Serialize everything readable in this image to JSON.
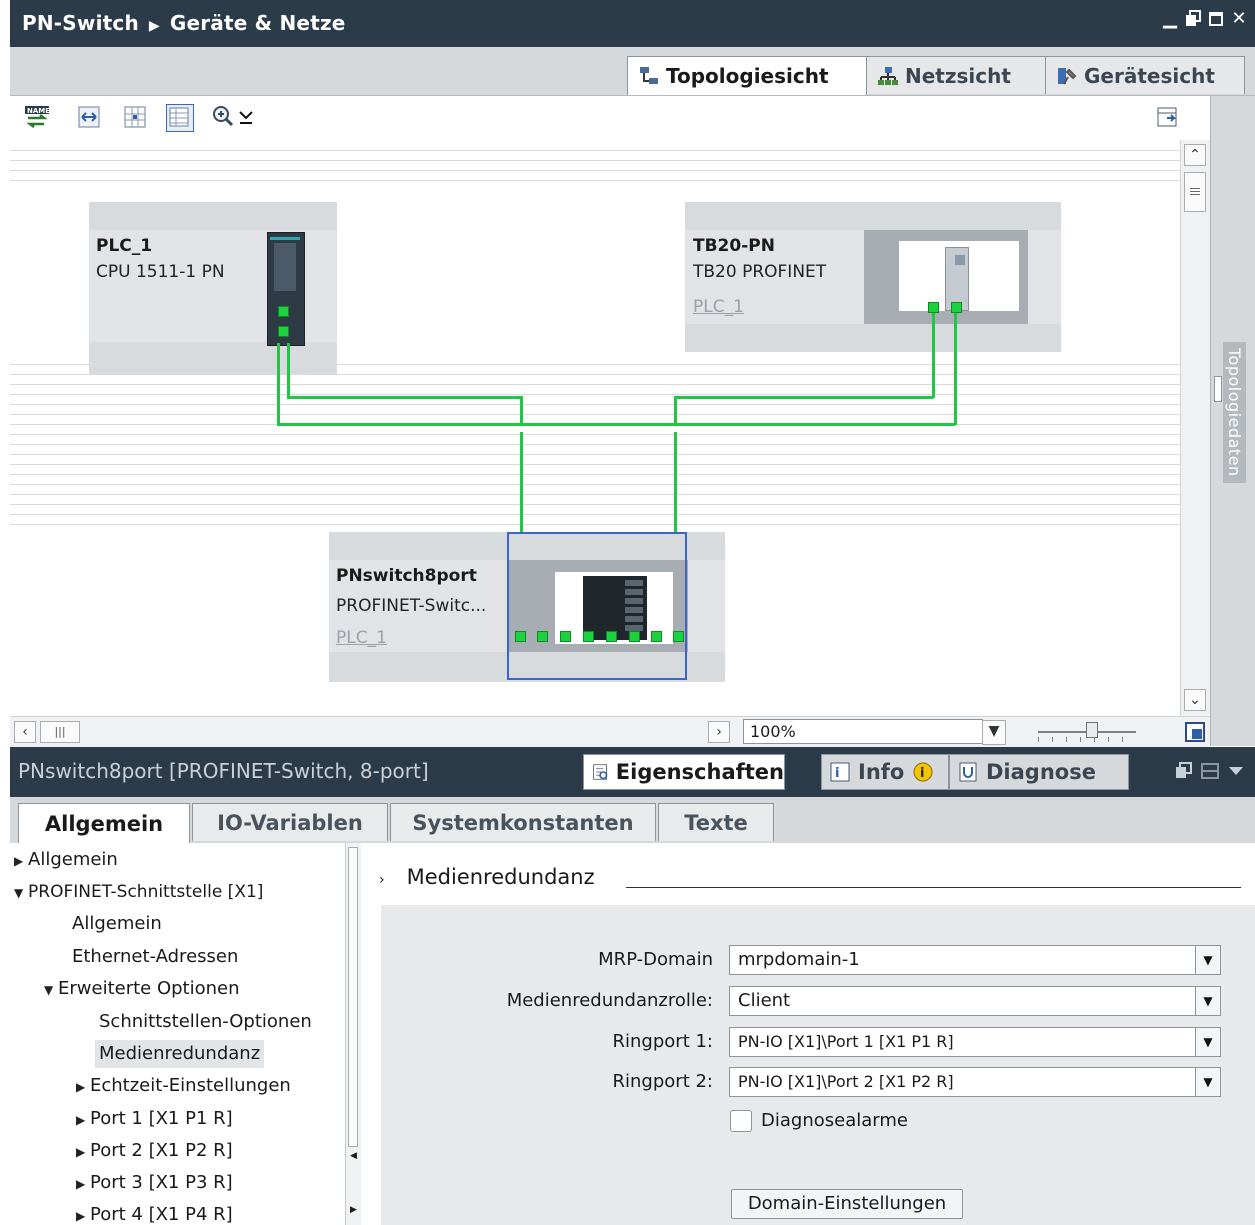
{
  "title_bar": {
    "project": "PN-Switch",
    "page": "Geräte & Netze"
  },
  "view_tabs": [
    {
      "label": "Topologiesicht",
      "icon": "topology-icon",
      "active": true
    },
    {
      "label": "Netzsicht",
      "icon": "network-icon",
      "active": false
    },
    {
      "label": "Gerätesicht",
      "icon": "device-icon",
      "active": false
    }
  ],
  "devices": {
    "plc": {
      "name": "PLC_1",
      "type": "CPU 1511-1 PN"
    },
    "tb20": {
      "name": "TB20-PN",
      "type": "TB20 PROFINET",
      "controller": "PLC_1"
    },
    "switch": {
      "name": "PNswitch8port",
      "type": "PROFINET-Switc...",
      "controller": "PLC_1"
    }
  },
  "side_panel_label": "Topologiedaten",
  "zoom": {
    "value": "100%"
  },
  "properties": {
    "title": "PNswitch8port [PROFINET-Switch, 8-port]",
    "tabs": [
      {
        "label": "Eigenschaften",
        "active": true
      },
      {
        "label": "Info",
        "active": false
      },
      {
        "label": "Diagnose",
        "active": false
      }
    ],
    "inner_tabs": [
      {
        "label": "Allgemein",
        "active": true
      },
      {
        "label": "IO-Variablen",
        "active": false
      },
      {
        "label": "Systemkonstanten",
        "active": false
      },
      {
        "label": "Texte",
        "active": false
      }
    ]
  },
  "nav": [
    {
      "label": "Allgemein",
      "state": "collapsed",
      "level": 0
    },
    {
      "label": "PROFINET-Schnittstelle [X1]",
      "state": "expanded",
      "level": 0
    },
    {
      "label": "Allgemein",
      "state": "leaf",
      "level": 1
    },
    {
      "label": "Ethernet-Adressen",
      "state": "leaf",
      "level": 1
    },
    {
      "label": "Erweiterte Optionen",
      "state": "expanded",
      "level": 1
    },
    {
      "label": "Schnittstellen-Optionen",
      "state": "leaf",
      "level": 2
    },
    {
      "label": "Medienredundanz",
      "state": "leaf",
      "level": 2,
      "selected": true
    },
    {
      "label": "Echtzeit-Einstellungen",
      "state": "collapsed",
      "level": 2
    },
    {
      "label": "Port 1 [X1 P1 R]",
      "state": "collapsed",
      "level": 2
    },
    {
      "label": "Port 2 [X1 P2 R]",
      "state": "collapsed",
      "level": 2
    },
    {
      "label": "Port 3 [X1 P3 R]",
      "state": "collapsed",
      "level": 2
    },
    {
      "label": "Port 4 [X1 P4 R]",
      "state": "collapsed",
      "level": 2
    }
  ],
  "section": {
    "title": "Medienredundanz",
    "fields": {
      "mrp_domain": {
        "label": "MRP-Domain",
        "value": "mrpdomain-1"
      },
      "role": {
        "label": "Medienredundanzrolle:",
        "value": "Client"
      },
      "ringport1": {
        "label": "Ringport 1:",
        "value": "PN-IO [X1]\\Port 1 [X1 P1 R]"
      },
      "ringport2": {
        "label": "Ringport 2:",
        "value": "PN-IO [X1]\\Port 2 [X1 P2 R]"
      }
    },
    "diag_label": "Diagnosealarme",
    "diag_checked": false,
    "domain_button": "Domain-Einstellungen"
  },
  "colors": {
    "link": "#22c544",
    "port": "#1ed13f",
    "header": "#2c3b4a",
    "selection": "#3a66c8"
  }
}
